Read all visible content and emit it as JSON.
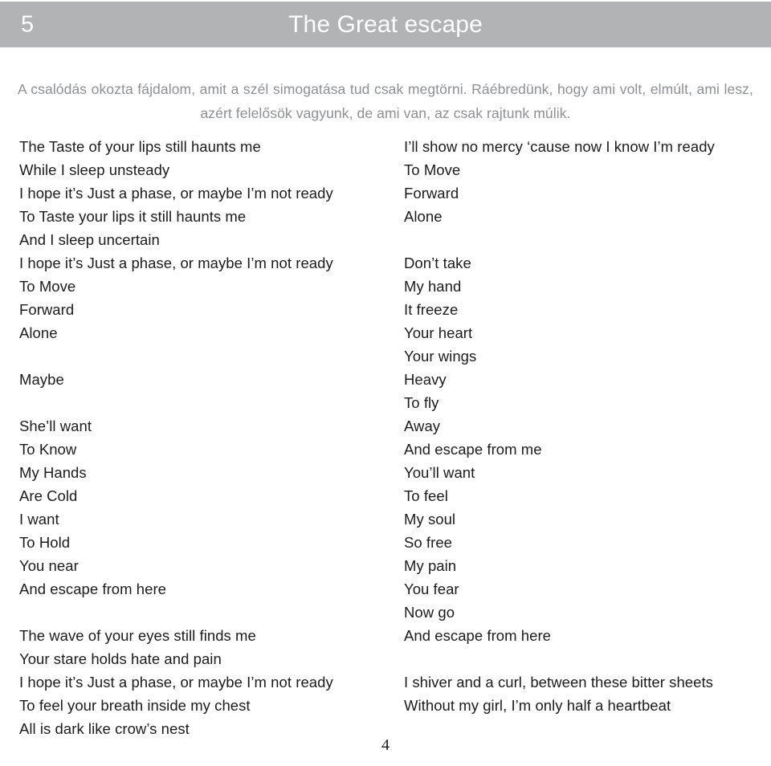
{
  "header": {
    "number": "5",
    "title": "The Great escape",
    "background_color": "#b1b3b5",
    "text_color": "#ffffff"
  },
  "quote": {
    "text": "A csalódás okozta fájdalom, amit a szél simogatása tud csak megtörni. Ráébredünk, hogy ami volt, elmúlt, ami lesz, azért felelősök vagyunk, de ami van, az csak rajtunk múlik.",
    "color": "#8e9093"
  },
  "lyrics": {
    "left_column": [
      {
        "lines": [
          "The Taste of your lips still haunts me",
          "While I sleep unsteady",
          "I hope it’s Just a phase, or maybe I’m not ready",
          "To Taste your lips it still haunts me",
          "And I sleep uncertain",
          "I hope it’s Just a phase, or maybe I’m not ready",
          "To Move",
          "Forward",
          "Alone"
        ]
      },
      {
        "lines": [
          "Maybe"
        ]
      },
      {
        "lines": [
          "She’ll want",
          "To Know",
          "My Hands",
          "Are Cold",
          "I want",
          "To Hold",
          "You near",
          "And escape from here"
        ]
      },
      {
        "lines": [
          "The wave of your eyes still finds me",
          "Your stare holds hate and pain",
          "I hope it’s Just a phase, or maybe I’m not ready",
          "To feel your breath inside my chest",
          "All is dark like crow’s nest"
        ]
      }
    ],
    "right_column": [
      {
        "lines": [
          "I’ll show no mercy ‘cause now I know I’m ready",
          "To Move",
          "Forward",
          "Alone"
        ]
      },
      {
        "lines": [
          "Don’t take",
          "My hand",
          "It freeze",
          "Your heart",
          "Your wings",
          "Heavy",
          "To fly",
          "Away",
          "And escape from me",
          "You’ll want",
          "To feel",
          "My soul",
          "So free",
          "My pain",
          "You fear",
          "Now go",
          "And escape from here"
        ]
      },
      {
        "lines": [
          "I shiver and a curl, between these bitter sheets",
          "Without my girl, I’m only half a heartbeat"
        ]
      }
    ]
  },
  "footer": {
    "page_number": "4"
  }
}
